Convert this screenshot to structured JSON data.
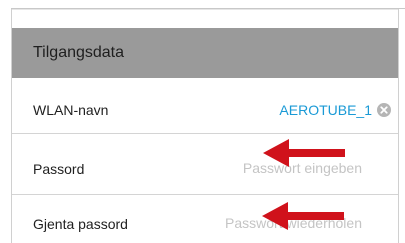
{
  "panel": {
    "title": "Tilgangsdata"
  },
  "rows": [
    {
      "label": "WLAN-navn",
      "value": "AEROTUBE_1",
      "clear_icon": "clear-circle-icon"
    },
    {
      "label": "Passord",
      "placeholder": "Passwort eingeben"
    },
    {
      "label": "Gjenta passord",
      "placeholder": "Passwort wiederholen"
    }
  ],
  "annotations": {
    "arrow_icon": "left-arrow-icon",
    "arrow_color": "#d0121b"
  },
  "colors": {
    "header_bg": "#9a9a9a",
    "link": "#1a9ad6",
    "placeholder": "#c4c4c4"
  }
}
